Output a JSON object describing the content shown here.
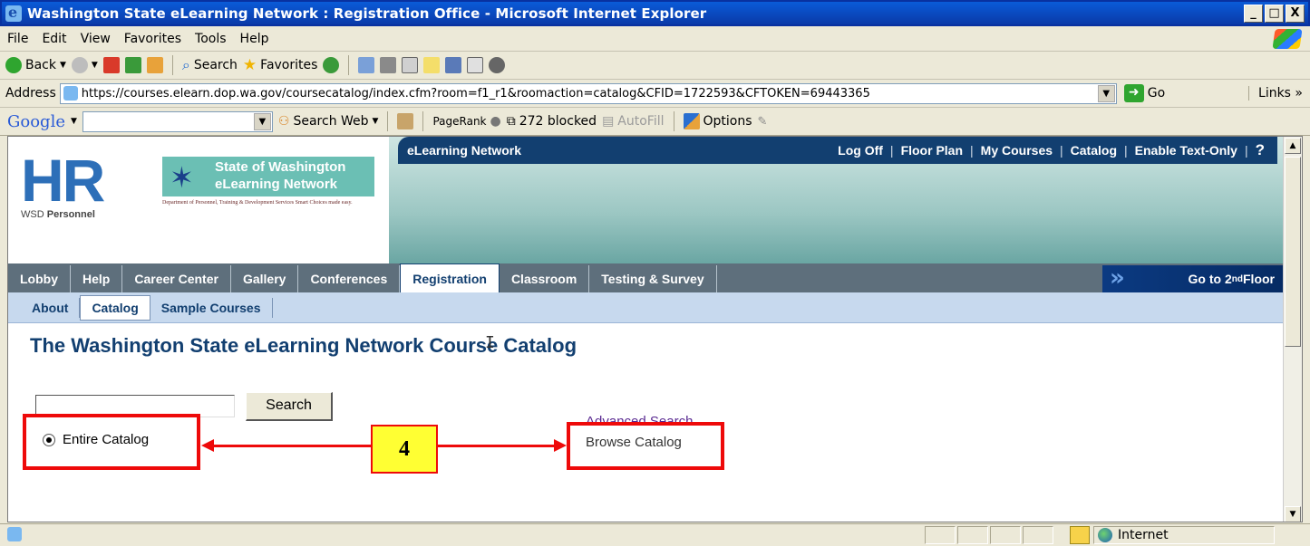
{
  "window": {
    "title": "Washington State eLearning Network : Registration Office - Microsoft Internet Explorer",
    "controls": [
      "_",
      "□",
      "X"
    ]
  },
  "menubar": [
    "File",
    "Edit",
    "View",
    "Favorites",
    "Tools",
    "Help"
  ],
  "toolbar": {
    "back": "Back",
    "search": "Search",
    "favorites": "Favorites"
  },
  "address": {
    "label": "Address",
    "url": "https://courses.elearn.dop.wa.gov/coursecatalog/index.cfm?room=f1_r1&roomaction=catalog&CFID=1722593&CFTOKEN=69443365",
    "go": "Go",
    "links": "Links »"
  },
  "googlebar": {
    "logo": "Google",
    "search_web": "Search Web",
    "pagerank": "PageRank",
    "blocked": "272 blocked",
    "autofill": "AutoFill",
    "options": "Options"
  },
  "header": {
    "hr_letters": "HR",
    "hr_sub_prefix": "WSD ",
    "hr_sub_bold": "Personnel",
    "wa_line1": "State of Washington",
    "wa_line2": "eLearning Network",
    "wa_caption": "Department of Personnel, Training & Development Services Smart Choices made easy."
  },
  "topnav": {
    "brand": "eLearning Network",
    "links": [
      "Log Off",
      "Floor Plan",
      "My Courses",
      "Catalog",
      "Enable Text-Only"
    ],
    "help": "?"
  },
  "tabs": [
    {
      "label": "Lobby",
      "active": false
    },
    {
      "label": "Help",
      "active": false
    },
    {
      "label": "Career Center",
      "active": false
    },
    {
      "label": "Gallery",
      "active": false
    },
    {
      "label": "Conferences",
      "active": false
    },
    {
      "label": "Registration",
      "active": true
    },
    {
      "label": "Classroom",
      "active": false
    },
    {
      "label": "Testing & Survey",
      "active": false
    }
  ],
  "floor_button": {
    "prefix": "Go to 2",
    "sup": "nd",
    "suffix": " Floor"
  },
  "subtabs": [
    {
      "label": "About",
      "active": false
    },
    {
      "label": "Catalog",
      "active": true
    },
    {
      "label": "Sample Courses",
      "active": false
    }
  ],
  "main": {
    "title": "The Washington State eLearning Network Course Catalog",
    "search_value": "",
    "search_button": "Search",
    "radio_label": "Entire Catalog",
    "advanced_search": "Advanced Search",
    "browse_catalog": "Browse Catalog"
  },
  "annotation": {
    "number": "4"
  },
  "statusbar": {
    "zone": "Internet"
  }
}
